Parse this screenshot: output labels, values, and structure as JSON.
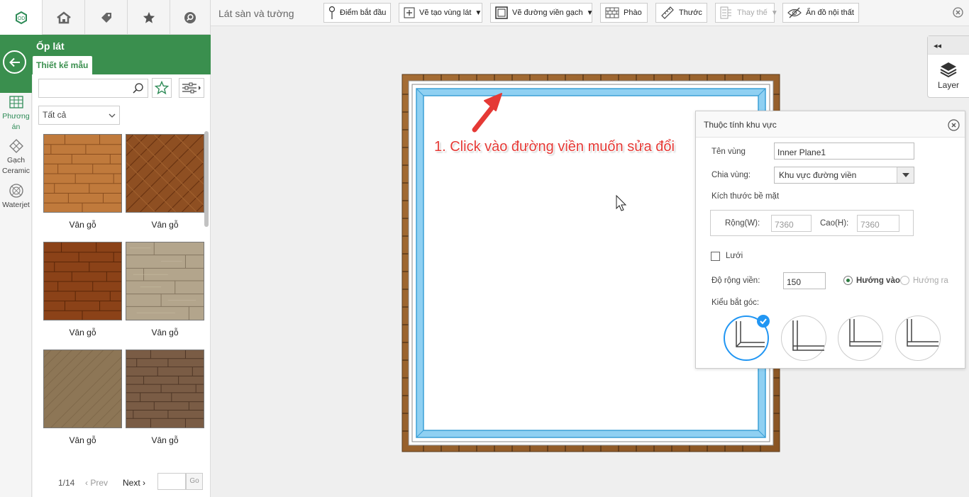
{
  "colors": {
    "brand_green": "#3a8f4e",
    "border_blue": "#8fd0f2",
    "wood_frame": "#9a6632",
    "annotation_red": "#e53935",
    "select_blue": "#2196f3"
  },
  "top_tabs": [
    {
      "icon": "logo-icon"
    },
    {
      "icon": "house-icon"
    },
    {
      "icon": "tag-icon"
    },
    {
      "icon": "star-icon"
    },
    {
      "icon": "search-circle-icon"
    }
  ],
  "panel": {
    "title": "Ốp lát",
    "subtab": "Thiết kế mẫu"
  },
  "sidebar": [
    {
      "label_1": "Phương",
      "label_2": "án",
      "icon": "grid-plan-icon"
    },
    {
      "label_1": "Gạch",
      "label_2": "Ceramic",
      "icon": "ceramic-tile-icon"
    },
    {
      "label_1": "Waterjet",
      "icon": "waterjet-icon"
    }
  ],
  "catalog": {
    "search_placeholder": "",
    "category": "Tất cả",
    "items": [
      {
        "label": "Vân gỗ"
      },
      {
        "label": "Vân gỗ"
      },
      {
        "label": "Vân gỗ"
      },
      {
        "label": "Vân gỗ"
      },
      {
        "label": "Vân gỗ"
      },
      {
        "label": "Vân gỗ"
      }
    ],
    "pager": {
      "page": "1/14",
      "prev": "Prev",
      "next": "Next",
      "go": "Go"
    }
  },
  "toolbar": {
    "title": "Lát sàn và tường",
    "buttons": [
      {
        "label": "Điểm bắt đầu",
        "icon": "pin-icon"
      },
      {
        "label": "Vẽ tạo vùng lát",
        "icon": "add-region-icon"
      },
      {
        "label": "Vẽ đường viền gạch",
        "icon": "border-square-icon"
      },
      {
        "label": "Phào",
        "icon": "brick-icon"
      },
      {
        "label": "Thước",
        "icon": "ruler-icon"
      },
      {
        "label": "Thay thế",
        "icon": "replace-icon"
      },
      {
        "label": "Ẩn đồ nội thất",
        "icon": "eye-hide-icon"
      }
    ]
  },
  "layer": {
    "label": "Layer",
    "collapse": "◂◂"
  },
  "annotation": "1. Click vào đường viền muốn sửa đổi",
  "properties": {
    "title": "Thuộc tính khu vực",
    "name_label": "Tên vùng",
    "name_value": "Inner Plane1",
    "region_label": "Chia vùng:",
    "region_value": "Khu vực đường viền",
    "surface_label": "Kích thước bề mặt",
    "width_label": "Rộng(W):",
    "width_value": "7360",
    "height_label": "Cao(H):",
    "height_value": "7360",
    "grid_label": "Lưới",
    "grid_checked": false,
    "border_width_label": "Độ rộng viền:",
    "border_width_value": "150",
    "dir_in": "Hướng vào",
    "dir_out": "Hướng ra",
    "dir_selected": "in",
    "corner_label": "Kiểu bắt góc:",
    "corner_selected": 0
  }
}
